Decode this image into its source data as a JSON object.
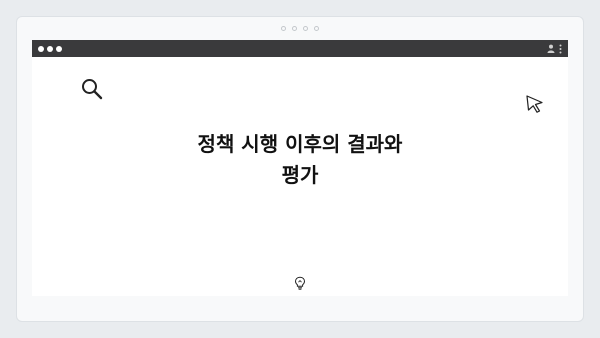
{
  "slide": {
    "title_line1": "정책 시행 이후의 결과와",
    "title_line2": "평가"
  },
  "icons": {
    "search": "search-icon",
    "cursor": "cursor-icon",
    "bulb": "lightbulb-icon",
    "user": "user-icon",
    "more": "more-icon"
  },
  "colors": {
    "titlebar": "#3a3a3c",
    "page_bg": "#e9ecef",
    "card_bg": "#f8f9fa"
  }
}
